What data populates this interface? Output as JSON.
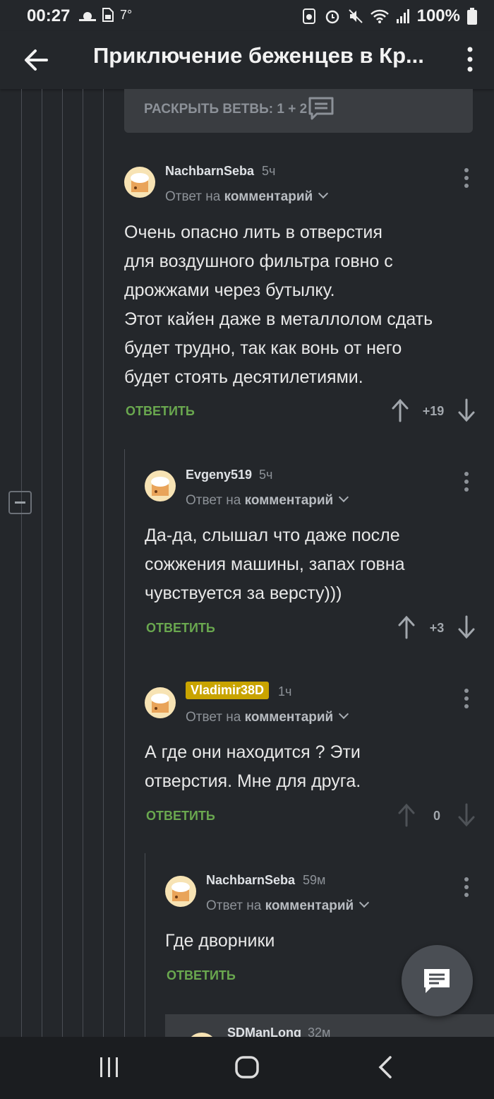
{
  "status_bar": {
    "time": "00:27",
    "temperature": "7°",
    "battery": "100%",
    "left_icons": [
      "weather-icon",
      "sim-icon"
    ],
    "right_icons": [
      "data-saver-icon",
      "alarm-icon",
      "mute-icon",
      "wifi-icon",
      "signal-icon",
      "battery-icon"
    ]
  },
  "app_bar": {
    "title": "Приключение беженцев  в Кр..."
  },
  "thread": {
    "expand_label": "РАСКРЫТЬ ВЕТВЬ: 1 + 2"
  },
  "comments": [
    {
      "author": "NachbarnSeba",
      "time": "5ч",
      "reply_prefix": "Ответ на",
      "reply_target": "комментарий",
      "lines": [
        "Очень опасно лить в отверстия",
        "для воздушного фильтра говно с",
        "дрожжами через бутылку.",
        "Этот кайен даже в металлолом сдать",
        "будет трудно, так как вонь от него",
        "будет стоять десятилетиями."
      ],
      "reply_label": "ОТВЕТИТЬ",
      "score": "+19"
    },
    {
      "author": "Evgeny519",
      "time": "5ч",
      "reply_prefix": "Ответ на",
      "reply_target": "комментарий",
      "lines": [
        "Да-да, слышал что даже после",
        "сожжения машины, запах говна",
        "чувствуется за версту)))"
      ],
      "reply_label": "ОТВЕТИТЬ",
      "score": "+3"
    },
    {
      "author": "Vladimir38D",
      "time": "1ч",
      "reply_prefix": "Ответ на",
      "reply_target": "комментарий",
      "lines": [
        "А где они находится ? Эти",
        "отверстия. Мне для друга."
      ],
      "reply_label": "ОТВЕТИТЬ",
      "score": "0"
    },
    {
      "author": "NachbarnSeba",
      "time": "59м",
      "reply_prefix": "Ответ на",
      "reply_target": "комментарий",
      "lines": [
        "Где дворники"
      ],
      "reply_label": "ОТВЕТИТЬ"
    },
    {
      "author": "SDManLong",
      "time": "32м"
    }
  ],
  "colors": {
    "background": "#24272b",
    "accent_green": "#6aa84f",
    "badge_gold": "#c9a400"
  }
}
